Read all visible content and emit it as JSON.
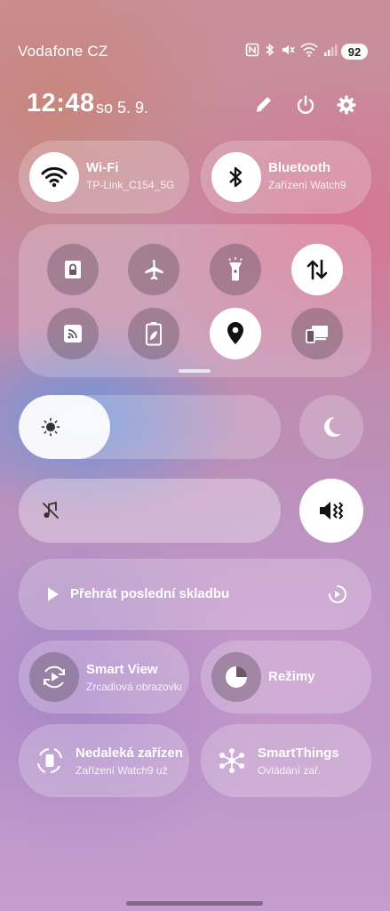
{
  "status_bar": {
    "carrier": "Vodafone CZ",
    "battery": "92",
    "icons": [
      "nfc-icon",
      "bluetooth-icon",
      "mute-icon",
      "wifi-icon",
      "signal-icon"
    ]
  },
  "header": {
    "time": "12:48",
    "date": "so 5. 9.",
    "icons": [
      "edit-icon",
      "power-icon",
      "settings-icon"
    ]
  },
  "wifi": {
    "title": "Wi-Fi",
    "subtitle": "TP-Link_C154_5G",
    "active": true
  },
  "bluetooth": {
    "title": "Bluetooth",
    "subtitle": "Zařízení Watch9",
    "active": true
  },
  "quick_toggles": [
    {
      "name": "screen-lock",
      "icon": "lock-icon",
      "active": false
    },
    {
      "name": "airplane-mode",
      "icon": "airplane-icon",
      "active": false
    },
    {
      "name": "flashlight",
      "icon": "flashlight-icon",
      "active": false
    },
    {
      "name": "mobile-data",
      "icon": "data-arrows-icon",
      "active": true
    },
    {
      "name": "nfc",
      "icon": "nfc-tile-icon",
      "active": false
    },
    {
      "name": "power-saving",
      "icon": "battery-leaf-icon",
      "active": false
    },
    {
      "name": "location",
      "icon": "location-icon",
      "active": true
    },
    {
      "name": "screen-sharing",
      "icon": "devices-icon",
      "active": false
    }
  ],
  "brightness": {
    "level": 0.35,
    "icon": "sun-icon"
  },
  "night_mode": {
    "icon": "moon-icon",
    "active": false
  },
  "volume": {
    "icon": "mute-note-icon"
  },
  "sound_mode": {
    "icon": "vibrate-mute-icon",
    "active": true
  },
  "media": {
    "label": "Přehrát poslední skladbu"
  },
  "tiles": {
    "smart_view": {
      "title": "Smart View",
      "subtitle": "Zrcadlová obrazovka"
    },
    "modes": {
      "title": "Režimy"
    },
    "nearby": {
      "title": "Nedaleká zařízení",
      "subtitle": "Zařízení Watch9 už"
    },
    "smartthings": {
      "title": "SmartThings",
      "subtitle": "Ovládání zař."
    }
  }
}
